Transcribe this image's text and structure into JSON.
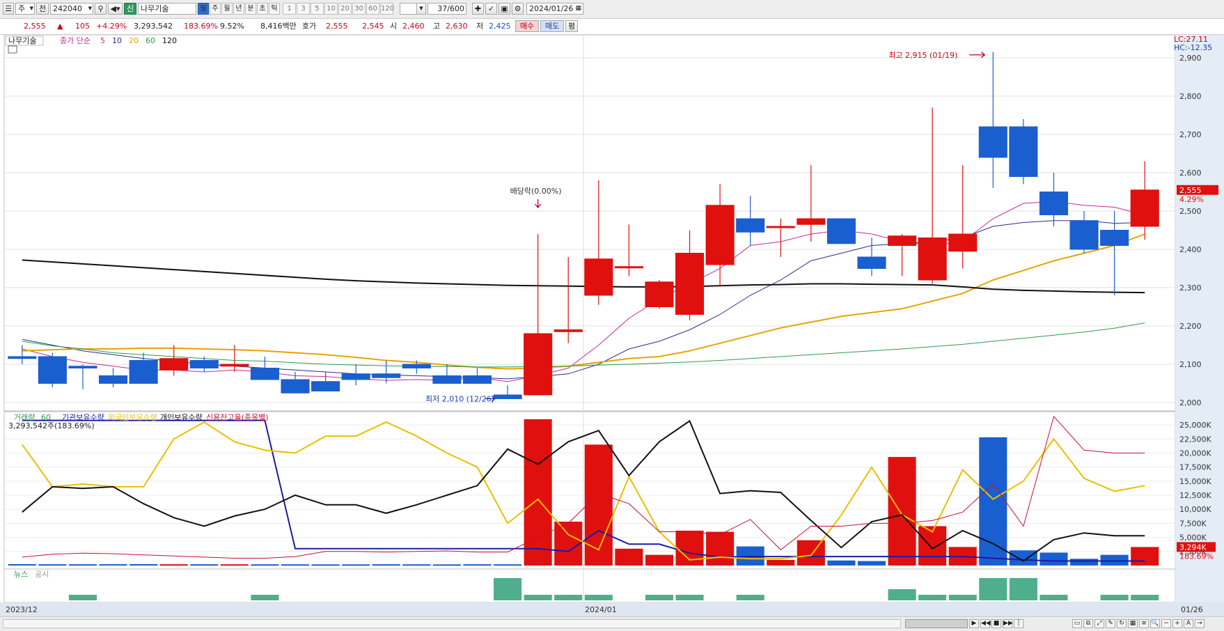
{
  "toolbar": {
    "market": "주",
    "prev": "전",
    "code": "242040",
    "sin": "신",
    "name": "나무기술",
    "periods": [
      "일",
      "주",
      "월",
      "년",
      "분",
      "초",
      "틱"
    ],
    "active_period": "일",
    "intervals": [
      "1",
      "3",
      "5",
      "10",
      "20",
      "30",
      "60",
      "120"
    ],
    "count": "37",
    "count_total": "/600",
    "date": "2024/01/26"
  },
  "quote": {
    "price": "2,555",
    "up_mark": "▲",
    "change": "105",
    "change_pct": "+4.29%",
    "volume": "3,293,542",
    "vol_ratio": "183.69%",
    "turnover": "9.52%",
    "amount": "8,416백만",
    "hoga_label": "호가",
    "ask": "2,555",
    "bid": "2,545",
    "open_label": "시",
    "open": "2,460",
    "high_label": "고",
    "high": "2,630",
    "low_label": "저",
    "low": "2,425",
    "buy": "매수",
    "sell": "매도",
    "avg": "평"
  },
  "price_pane": {
    "legend_name": "나무기술",
    "legend_ma_label": "종가 단순",
    "ma_periods": [
      "5",
      "10",
      "20",
      "60",
      "120"
    ],
    "ma_colors": [
      "#c5299b",
      "#2b2b8e",
      "#e8a300",
      "#2e9a4e",
      "#111111"
    ],
    "lc": "LC:27.11",
    "hc": "HC:-12.35",
    "price_tag": "2,555",
    "price_tag_pct": "4.29%",
    "high_note": "최고 2,915 (01/19)",
    "low_note": "최저 2,010 (12/26)",
    "ex_div_note": "배당락(0.00%)",
    "y_ticks": [
      "2,900",
      "2,800",
      "2,700",
      "2,600",
      "2,500",
      "2,400",
      "2,300",
      "2,200",
      "2,100",
      "2,000"
    ]
  },
  "volume_pane": {
    "legend": [
      "거래량",
      "60",
      "기관보유수량",
      "외국인보유수량",
      "개인보유수량",
      "신용잔고율(종목별)"
    ],
    "legend_colors": [
      "#2e9a4e",
      "#2e9a4e",
      "#1a1aa8",
      "#e8c000",
      "#111111",
      "#c8102e"
    ],
    "current_label": "3,293,542주(183.69%)",
    "y_ticks": [
      "25,000K",
      "22,500K",
      "20,000K",
      "17,500K",
      "15,000K",
      "12,500K",
      "10,000K",
      "7,500K",
      "5,000K",
      "2,500K"
    ],
    "vol_tag": "3,294K",
    "vol_tag_pct": "183.69%"
  },
  "news_pane": {
    "legend": [
      "뉴스",
      "공시"
    ]
  },
  "date_axis": {
    "labels": [
      "2023/12",
      "2024/01",
      "01/26"
    ]
  },
  "chart_data": {
    "type": "candlestick",
    "dates": [
      "12/01",
      "12/04",
      "12/05",
      "12/06",
      "12/07",
      "12/08",
      "12/11",
      "12/12",
      "12/13",
      "12/14",
      "12/15",
      "12/18",
      "12/19",
      "12/20",
      "12/21",
      "12/22",
      "12/26",
      "12/27",
      "12/28",
      "01/02",
      "01/03",
      "01/04",
      "01/05",
      "01/08",
      "01/09",
      "01/10",
      "01/11",
      "01/12",
      "01/15",
      "01/16",
      "01/17",
      "01/18",
      "01/19",
      "01/22",
      "01/23",
      "01/24",
      "01/25",
      "01/26"
    ],
    "open": [
      2120,
      2120,
      2095,
      2070,
      2110,
      2085,
      2110,
      2095,
      2090,
      2060,
      2055,
      2075,
      2075,
      2100,
      2070,
      2070,
      2020,
      2020,
      2185,
      2280,
      2355,
      2250,
      2230,
      2360,
      2480,
      2460,
      2465,
      2480,
      2380,
      2410,
      2320,
      2395,
      2720,
      2720,
      2550,
      2475,
      2450,
      2460
    ],
    "high": [
      2150,
      2130,
      2100,
      2090,
      2130,
      2150,
      2120,
      2150,
      2120,
      2080,
      2080,
      2100,
      2110,
      2110,
      2100,
      2090,
      2045,
      2440,
      2380,
      2580,
      2465,
      2320,
      2450,
      2570,
      2540,
      2480,
      2620,
      2470,
      2430,
      2440,
      2770,
      2620,
      2915,
      2740,
      2600,
      2500,
      2500,
      2630
    ],
    "low": [
      2100,
      2040,
      2035,
      2040,
      2050,
      2070,
      2080,
      2080,
      2060,
      2025,
      2030,
      2045,
      2050,
      2075,
      2050,
      2050,
      2010,
      2020,
      2155,
      2255,
      2330,
      2245,
      2215,
      2305,
      2410,
      2380,
      2420,
      2420,
      2330,
      2330,
      2310,
      2350,
      2560,
      2570,
      2460,
      2390,
      2280,
      2425
    ],
    "close": [
      2115,
      2050,
      2090,
      2050,
      2050,
      2115,
      2090,
      2100,
      2060,
      2025,
      2030,
      2060,
      2065,
      2090,
      2050,
      2050,
      2010,
      2180,
      2190,
      2375,
      2355,
      2315,
      2390,
      2515,
      2445,
      2460,
      2480,
      2415,
      2350,
      2435,
      2430,
      2440,
      2640,
      2590,
      2490,
      2400,
      2410,
      2555
    ],
    "ma5": [
      2140,
      2120,
      2105,
      2095,
      2085,
      2085,
      2080,
      2085,
      2080,
      2070,
      2068,
      2062,
      2058,
      2060,
      2058,
      2065,
      2055,
      2070,
      2090,
      2150,
      2220,
      2270,
      2310,
      2350,
      2410,
      2420,
      2440,
      2450,
      2440,
      2420,
      2410,
      2420,
      2480,
      2520,
      2525,
      2515,
      2510,
      2490
    ],
    "ma10": [
      2165,
      2150,
      2135,
      2125,
      2115,
      2108,
      2100,
      2095,
      2090,
      2085,
      2080,
      2075,
      2072,
      2070,
      2068,
      2065,
      2062,
      2068,
      2075,
      2100,
      2140,
      2160,
      2190,
      2230,
      2280,
      2320,
      2370,
      2390,
      2410,
      2415,
      2420,
      2430,
      2460,
      2470,
      2475,
      2475,
      2468,
      2470
    ],
    "ma20": [
      2135,
      2138,
      2140,
      2140,
      2142,
      2142,
      2140,
      2138,
      2135,
      2130,
      2125,
      2118,
      2110,
      2105,
      2098,
      2092,
      2088,
      2090,
      2095,
      2105,
      2115,
      2120,
      2135,
      2155,
      2175,
      2195,
      2210,
      2225,
      2235,
      2245,
      2265,
      2285,
      2320,
      2345,
      2370,
      2390,
      2410,
      2440
    ],
    "ma60": [
      2160,
      2148,
      2140,
      2130,
      2125,
      2120,
      2115,
      2110,
      2108,
      2104,
      2100,
      2098,
      2096,
      2094,
      2094,
      2093,
      2093,
      2094,
      2095,
      2098,
      2100,
      2103,
      2106,
      2110,
      2115,
      2120,
      2125,
      2130,
      2135,
      2140,
      2146,
      2152,
      2160,
      2168,
      2176,
      2184,
      2194,
      2208
    ],
    "ma120": [
      2372,
      2367,
      2362,
      2357,
      2352,
      2347,
      2342,
      2337,
      2332,
      2327,
      2322,
      2318,
      2315,
      2312,
      2310,
      2308,
      2306,
      2305,
      2304,
      2303,
      2302,
      2302,
      2303,
      2305,
      2307,
      2308,
      2310,
      2310,
      2309,
      2308,
      2307,
      2302,
      2296,
      2293,
      2291,
      2289,
      2288,
      2287
    ],
    "volume_k": [
      250,
      230,
      230,
      240,
      250,
      230,
      230,
      220,
      220,
      220,
      210,
      210,
      230,
      220,
      210,
      230,
      220,
      26000,
      7800,
      21500,
      3000,
      1900,
      6200,
      6000,
      3400,
      1000,
      4500,
      900,
      800,
      19300,
      7000,
      3300,
      22800,
      2700,
      2300,
      1200,
      1900,
      3294
    ],
    "institution_k": [
      25800,
      25800,
      25800,
      25800,
      25800,
      25800,
      25800,
      25800,
      25800,
      3000,
      3000,
      3000,
      3000,
      3000,
      3000,
      3000,
      3000,
      3000,
      2500,
      6200,
      3800,
      3800,
      2200,
      1500,
      1600,
      1600,
      1600,
      1600,
      1600,
      1600,
      1600,
      1600,
      1300,
      1000,
      800,
      800,
      800,
      800
    ],
    "foreign_k": [
      21500,
      14000,
      14500,
      14000,
      14000,
      22500,
      25500,
      22000,
      20500,
      20000,
      23000,
      23000,
      25500,
      23000,
      20000,
      17500,
      7500,
      11800,
      5500,
      2800,
      15800,
      6000,
      1000,
      1500,
      1200,
      1200,
      1800,
      9000,
      17500,
      9000,
      6000,
      17000,
      11800,
      15000,
      22500,
      15500,
      13200,
      14200
    ],
    "individual_k": [
      9500,
      14000,
      13700,
      14000,
      11000,
      8500,
      7000,
      8800,
      10000,
      12500,
      10800,
      10800,
      9300,
      10800,
      12500,
      14200,
      20700,
      18000,
      22000,
      24000,
      16000,
      22000,
      25700,
      12800,
      13300,
      13000,
      8000,
      3200,
      7800,
      9000,
      3000,
      6200,
      3900,
      800,
      4600,
      5800,
      5300,
      5300
    ],
    "credit_k": [
      1500,
      2000,
      2200,
      2100,
      1900,
      1700,
      1500,
      1300,
      1300,
      1600,
      2500,
      2500,
      2400,
      2500,
      2600,
      2400,
      2400,
      5000,
      7500,
      12800,
      11000,
      6000,
      6000,
      5500,
      8200,
      2800,
      7000,
      7000,
      7500,
      7500,
      8000,
      9500,
      14500,
      7000,
      26500,
      20500,
      20000,
      20000
    ],
    "news": [
      0,
      0,
      1,
      0,
      0,
      0,
      0,
      0,
      1,
      0,
      0,
      0,
      0,
      0,
      0,
      0,
      4,
      1,
      1,
      1,
      0,
      1,
      1,
      0,
      1,
      0,
      0,
      0,
      0,
      2,
      1,
      1,
      4,
      4,
      1,
      0,
      1,
      1
    ],
    "price_range": [
      2000,
      2920
    ],
    "volume_range": [
      0,
      26000
    ]
  }
}
